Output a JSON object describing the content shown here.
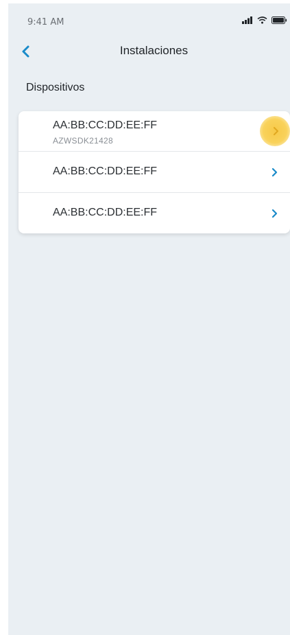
{
  "status_bar": {
    "time": "9:41 AM"
  },
  "nav": {
    "title": "Instalaciones",
    "back_icon": "chevron-left-icon"
  },
  "section": {
    "title": "Dispositivos"
  },
  "devices": [
    {
      "mac": "AA:BB:CC:DD:EE:FF",
      "serial": "AZWSDK21428",
      "highlighted": true
    },
    {
      "mac": "AA:BB:CC:DD:EE:FF"
    },
    {
      "mac": "AA:BB:CC:DD:EE:FF"
    }
  ],
  "colors": {
    "accent": "#1a8bc9",
    "background": "#eaeff3",
    "highlight": "#f7c948"
  }
}
